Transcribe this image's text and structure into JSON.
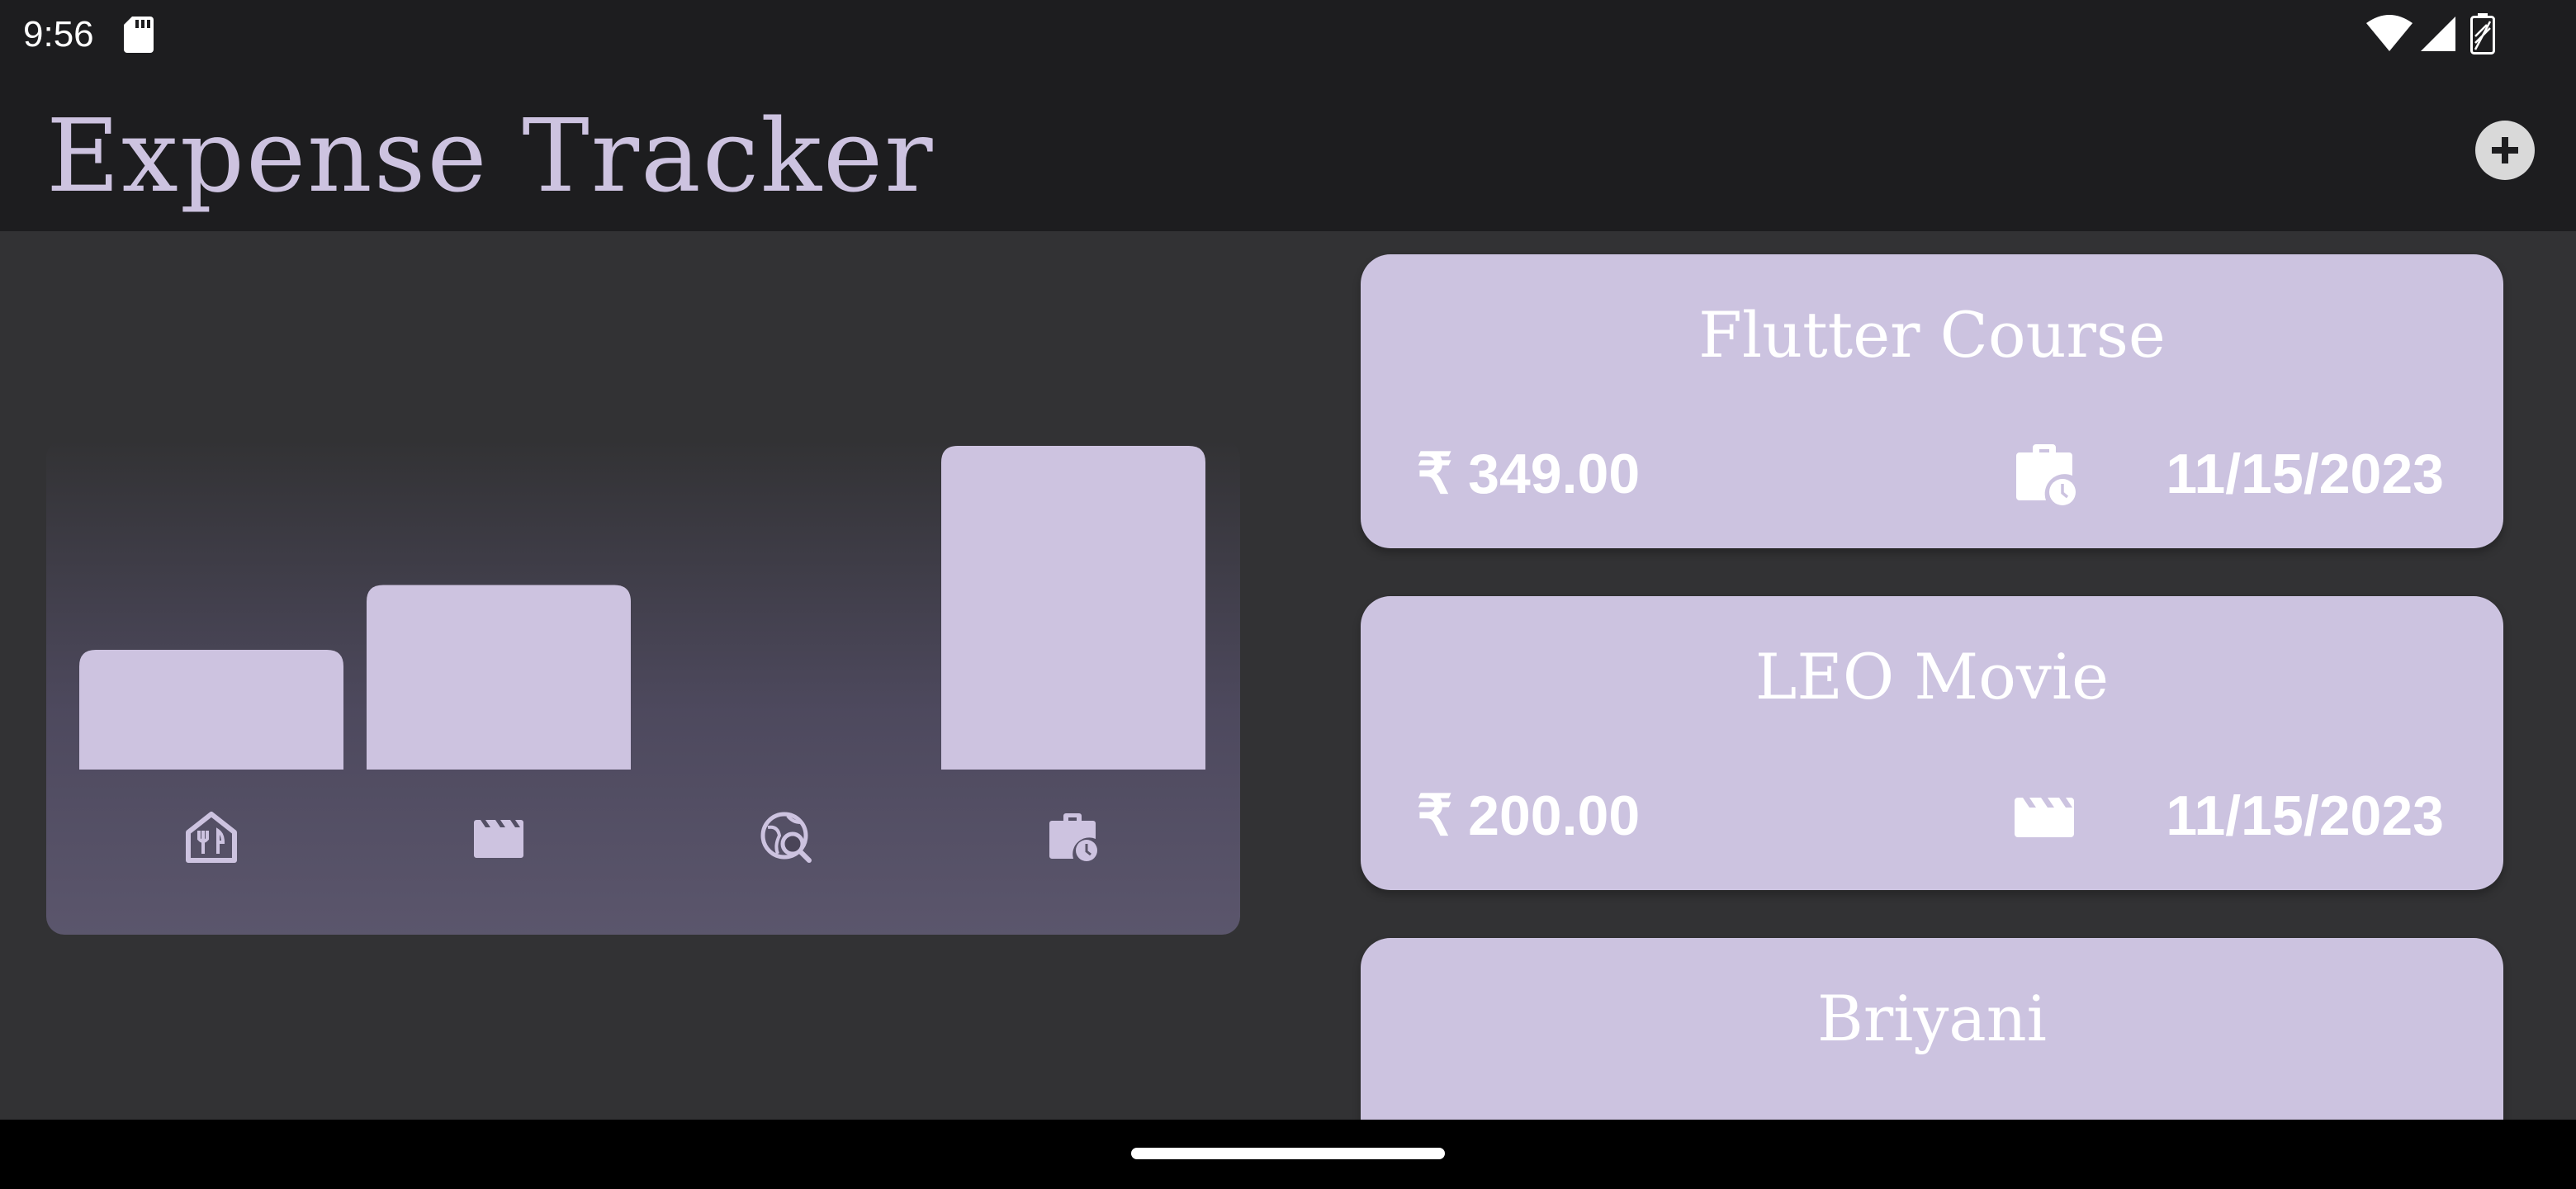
{
  "status_bar": {
    "time": "9:56",
    "icons": [
      "sd-card-icon",
      "wifi-icon",
      "signal-icon",
      "battery-icon"
    ]
  },
  "app_bar": {
    "title": "Expense Tracker",
    "action_icon": "add-circle-icon"
  },
  "colors": {
    "accent": "#cdc3e0",
    "card_bg": "#ccc3e0",
    "background": "#323234",
    "bar_bg": "#1d1d1f"
  },
  "chart_data": {
    "type": "bar",
    "categories": [
      "food",
      "leisure",
      "travel",
      "work"
    ],
    "category_icons": [
      "restaurant-icon",
      "movie-icon",
      "travel-explore-icon",
      "work-history-icon"
    ],
    "values": [
      0.37,
      0.57,
      0.0,
      1.0
    ],
    "ylim": [
      0,
      1
    ]
  },
  "expenses": [
    {
      "title": "Flutter Course",
      "amount": "₹ 349.00",
      "category_icon": "work-history-icon",
      "date": "11/15/2023"
    },
    {
      "title": "LEO Movie",
      "amount": "₹ 200.00",
      "category_icon": "movie-icon",
      "date": "11/15/2023"
    },
    {
      "title": "Briyani"
    }
  ]
}
